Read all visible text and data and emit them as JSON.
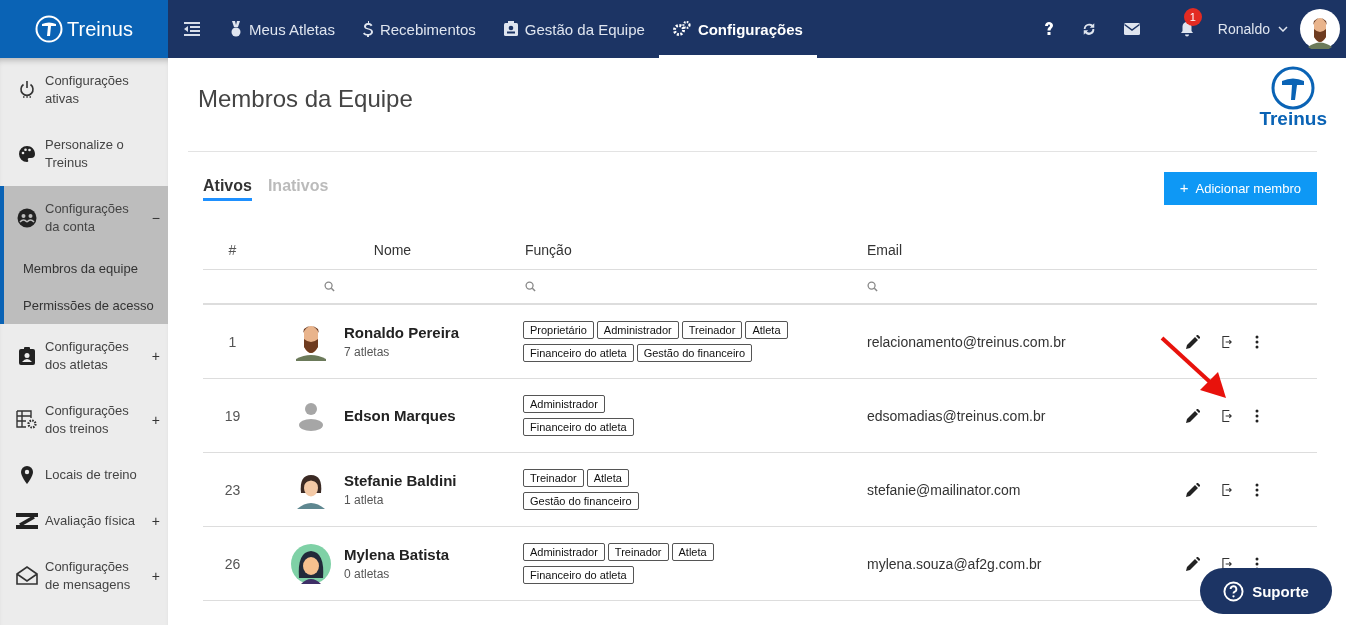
{
  "brand": {
    "name": "Treinus"
  },
  "nav": {
    "items": [
      {
        "label": "Meus Atletas",
        "selected": false
      },
      {
        "label": "Recebimentos",
        "selected": false
      },
      {
        "label": "Gestão da Equipe",
        "selected": false
      },
      {
        "label": "Configurações",
        "selected": true
      }
    ],
    "notification_count": "1",
    "user_name": "Ronaldo"
  },
  "sidebar": {
    "items": [
      {
        "label": "Configurações ativas",
        "selected": false
      },
      {
        "label": "Personalize o Treinus",
        "selected": false
      },
      {
        "label": "Configurações da conta",
        "toggle": "−",
        "selected": true,
        "children": [
          {
            "label": "Membros da equipe"
          },
          {
            "label": "Permissões de acesso"
          }
        ]
      },
      {
        "label": "Configurações dos atletas",
        "toggle": "+",
        "selected": false
      },
      {
        "label": "Configurações dos treinos",
        "toggle": "+",
        "selected": false
      },
      {
        "label": "Locais de treino",
        "selected": false
      },
      {
        "label": "Avaliação física",
        "toggle": "+",
        "selected": false
      },
      {
        "label": "Configurações de mensagens",
        "toggle": "+",
        "selected": false
      }
    ]
  },
  "page": {
    "title": "Membros da Equipe",
    "logo_text": "Treinus"
  },
  "tabs": [
    {
      "label": "Ativos",
      "selected": true
    },
    {
      "label": "Inativos",
      "selected": false
    }
  ],
  "add_button": {
    "icon": "+",
    "label": "Adicionar membro"
  },
  "table": {
    "columns": [
      "#",
      "Nome",
      "Função",
      "Email"
    ],
    "rows": [
      {
        "number": "1",
        "avatar": {
          "kind": "bearded"
        },
        "name": "Ronaldo Pereira",
        "subtitle": "7 atletas",
        "role_lines": [
          [
            "Proprietário",
            "Administrador",
            "Treinador",
            "Atleta"
          ],
          [
            "Financeiro do atleta",
            "Gestão do financeiro"
          ]
        ],
        "email": "relacionamento@treinus.com.br"
      },
      {
        "number": "19",
        "avatar": {
          "kind": "default"
        },
        "name": "Edson Marques",
        "role_lines": [
          [
            "Administrador"
          ],
          [
            "Financeiro do atleta"
          ]
        ],
        "email": "edsomadias@treinus.com.br"
      },
      {
        "number": "23",
        "avatar": {
          "kind": "woman"
        },
        "name": "Stefanie Baldini",
        "subtitle": "1 atleta",
        "role_lines": [
          [
            "Treinador",
            "Atleta"
          ],
          [
            "Gestão do financeiro"
          ]
        ],
        "email": "stefanie@mailinator.com"
      },
      {
        "number": "26",
        "avatar": {
          "kind": "woman-circle"
        },
        "name": "Mylena Batista",
        "subtitle": "0 atletas",
        "role_lines": [
          [
            "Administrador",
            "Treinador",
            "Atleta"
          ],
          [
            "Financeiro do atleta"
          ]
        ],
        "email": "mylena.souza@af2g.com.br"
      }
    ]
  },
  "support_button": {
    "label": "Suporte"
  }
}
